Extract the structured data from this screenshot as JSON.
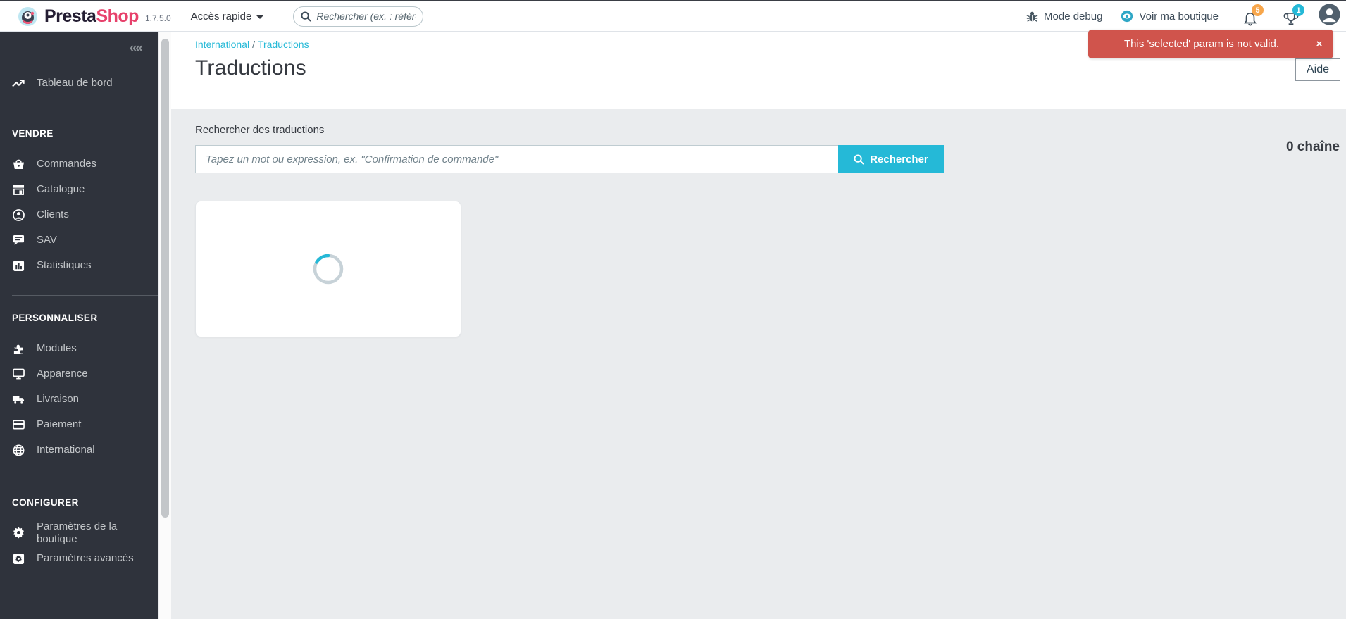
{
  "topbar": {
    "brand_presta": "Presta",
    "brand_shop": "Shop",
    "version": "1.7.5.0",
    "quick_access": "Accès rapide",
    "search_placeholder": "Rechercher (ex. : référe",
    "debug_label": "Mode debug",
    "shop_link": "Voir ma boutique",
    "notification_badge": "5",
    "trophy_badge": "1"
  },
  "sidebar": {
    "collapse": "««",
    "dashboard": "Tableau de bord",
    "sections": [
      {
        "title": "VENDRE",
        "items": [
          "Commandes",
          "Catalogue",
          "Clients",
          "SAV",
          "Statistiques"
        ]
      },
      {
        "title": "PERSONNALISER",
        "items": [
          "Modules",
          "Apparence",
          "Livraison",
          "Paiement",
          "International"
        ]
      },
      {
        "title": "CONFIGURER",
        "items": [
          "Paramètres de la boutique",
          "Paramètres avancés"
        ]
      }
    ]
  },
  "page": {
    "breadcrumb_parent": "International",
    "breadcrumb_sep": "/",
    "breadcrumb_current": "Traductions",
    "title": "Traductions",
    "help_button": "Aide"
  },
  "toast": {
    "message": "This 'selected' param is not valid.",
    "close": "×"
  },
  "search_panel": {
    "label": "Rechercher des traductions",
    "placeholder": "Tapez un mot ou expression, ex. \"Confirmation de commande\"",
    "button": "Rechercher",
    "count": "0 chaîne"
  },
  "colors": {
    "accent": "#25b9d7",
    "toast_bg": "#d0544c",
    "sidebar_bg": "#2f333c",
    "badge_orange": "#f7a64b",
    "brand_pink": "#e7416b"
  }
}
